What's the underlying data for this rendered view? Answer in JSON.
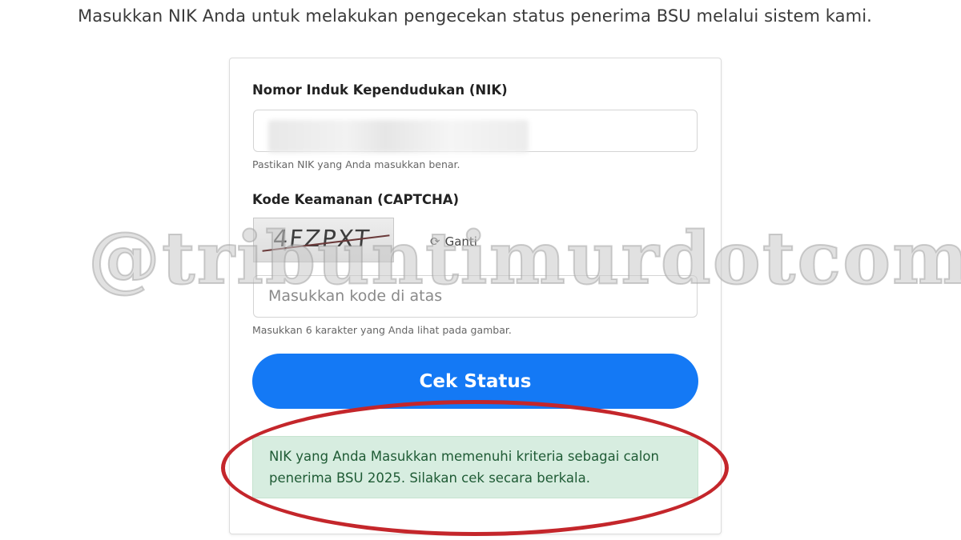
{
  "intro_text": "Masukkan NIK Anda untuk melakukan pengecekan status penerima BSU melalui sistem kami.",
  "form": {
    "nik": {
      "label": "Nomor Induk Kependudukan (NIK)",
      "hint": "Pastikan NIK yang Anda masukkan benar."
    },
    "captcha": {
      "label": "Kode Keamanan (CAPTCHA)",
      "image_text": "4FZPXT",
      "refresh_icon": "refresh-icon",
      "refresh_label": "Ganti",
      "placeholder": "Masukkan kode di atas",
      "hint": "Masukkan 6 karakter yang Anda lihat pada gambar."
    },
    "submit_label": "Cek Status"
  },
  "result": {
    "message": "NIK yang Anda Masukkan memenuhi kriteria sebagai calon penerima BSU 2025. Silakan cek secara berkala."
  },
  "watermark": "@tribuntimurdotcom",
  "colors": {
    "button": "#1479f5",
    "alert_bg": "#d7ede0",
    "alert_text": "#1f5b35",
    "annotation": "#c4262b"
  }
}
